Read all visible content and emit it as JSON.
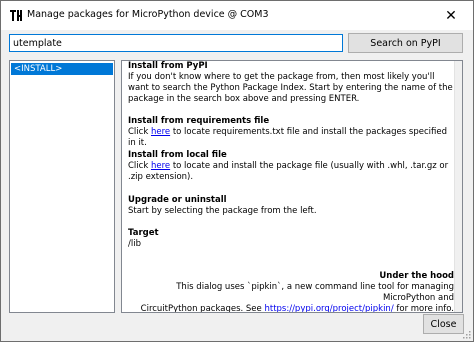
{
  "window": {
    "title": "Manage packages for MicroPython device @ COM3",
    "close_glyph": "✕",
    "icon": "thonny-app-icon"
  },
  "search": {
    "value": "utemplate",
    "button_label": "Search on PyPI"
  },
  "package_list": {
    "items": [
      {
        "label": "<INSTALL>",
        "selected": true
      }
    ]
  },
  "info": {
    "pypi": {
      "heading": "Install from PyPI",
      "text": "If you don't know where to get the package from, then most likely you'll want to search the Python Package Index. Start by entering the name of the package in the search box above and pressing ENTER."
    },
    "requirements": {
      "heading": "Install from requirements file",
      "before": "Click ",
      "link": "here",
      "after": " to locate requirements.txt file and install the packages specified in it."
    },
    "local": {
      "heading": "Install from local file",
      "before": "Click ",
      "link": "here",
      "after": " to locate and install the package file (usually with .whl, .tar.gz or .zip extension)."
    },
    "upgrade": {
      "heading": "Upgrade or uninstall",
      "text": "Start by selecting the package from the left."
    },
    "target": {
      "heading": "Target",
      "text": "/lib"
    },
    "hood": {
      "heading": "Under the hood",
      "line1": "This dialog uses `pipkin`, a new command line tool for managing MicroPython and",
      "line2_before": "CircuitPython packages. See ",
      "link": "https://pypi.org/project/pipkin/",
      "line2_after": " for more info."
    }
  },
  "footer": {
    "close_label": "Close"
  },
  "colors": {
    "accent": "#0078d7",
    "link": "#0000ee",
    "dialog_bg": "#f0f0f0",
    "button_bg": "#e1e1e1"
  }
}
